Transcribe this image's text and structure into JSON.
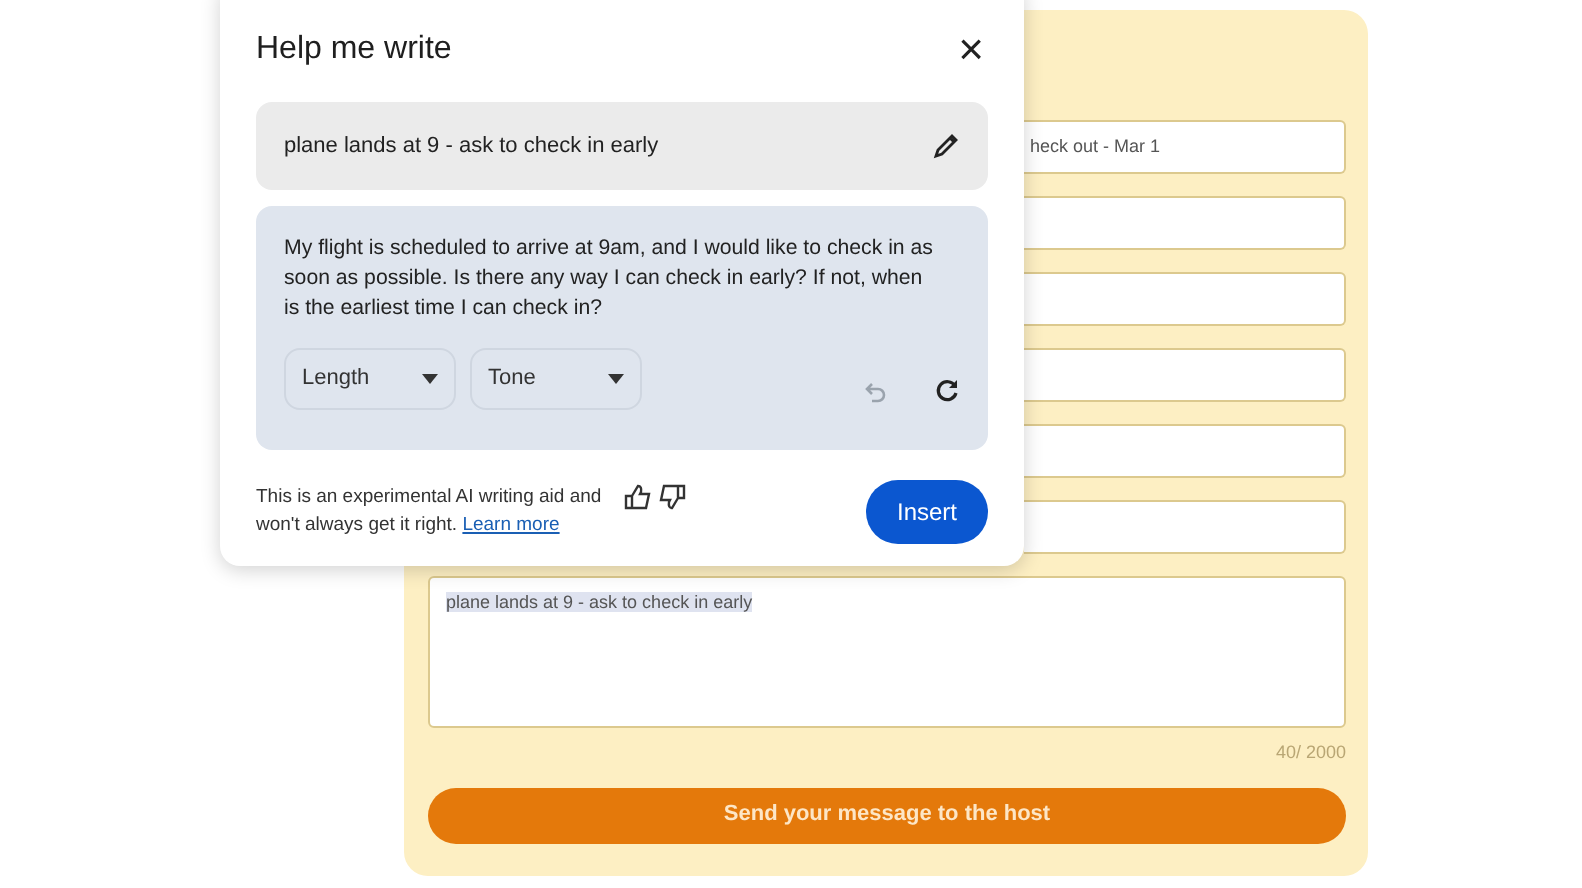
{
  "form": {
    "fields": [
      {
        "kind": "filled",
        "value": "heck out - Mar 1"
      },
      {
        "kind": "empty"
      },
      {
        "kind": "empty"
      },
      {
        "kind": "empty"
      },
      {
        "kind": "empty"
      },
      {
        "kind": "empty"
      }
    ],
    "message": {
      "value": "plane lands at 9 - ask to check in early",
      "counter": "40/ 2000"
    },
    "send_button": "Send your message to the host"
  },
  "dialog": {
    "title": "Help me write",
    "close": "×",
    "prompt": "plane lands at 9 - ask to check in early",
    "response": "My flight is scheduled to arrive at 9am, and I would like to check in as soon as possible. Is there any way I can check in early? If not, when is the earliest time I can check in?",
    "dropdowns": [
      {
        "label": "Length"
      },
      {
        "label": "Tone"
      }
    ],
    "undo_disabled": true,
    "disclaimer": "This is an experimental AI writing aid and won't always get it right.",
    "learn_more": "Learn more",
    "insert_button": "Insert"
  }
}
